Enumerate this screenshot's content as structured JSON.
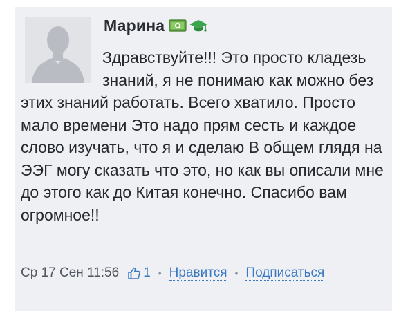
{
  "comment": {
    "author": "Марина",
    "badges": [
      "money-icon",
      "graduation-cap-icon"
    ],
    "text": "Здравствуйте!!! Это просто кладезь знаний, я не понимаю как можно без этих знаний работать. Всего хватило. Просто мало времени Это надо прям сесть и каждое слово изучать, что я и сделаю В общем глядя на ЭЭГ могу сказать что это, но как вы описали мне до этого как до Китая конечно. Спасибо вам огромное!!",
    "date": "Ср 17 Сен 11:56",
    "likes_count": "1",
    "like_label": "Нравится",
    "subscribe_label": "Подписаться"
  },
  "colors": {
    "card_background": "#eef0f4",
    "link": "#3b78c2",
    "text": "#25282d"
  }
}
